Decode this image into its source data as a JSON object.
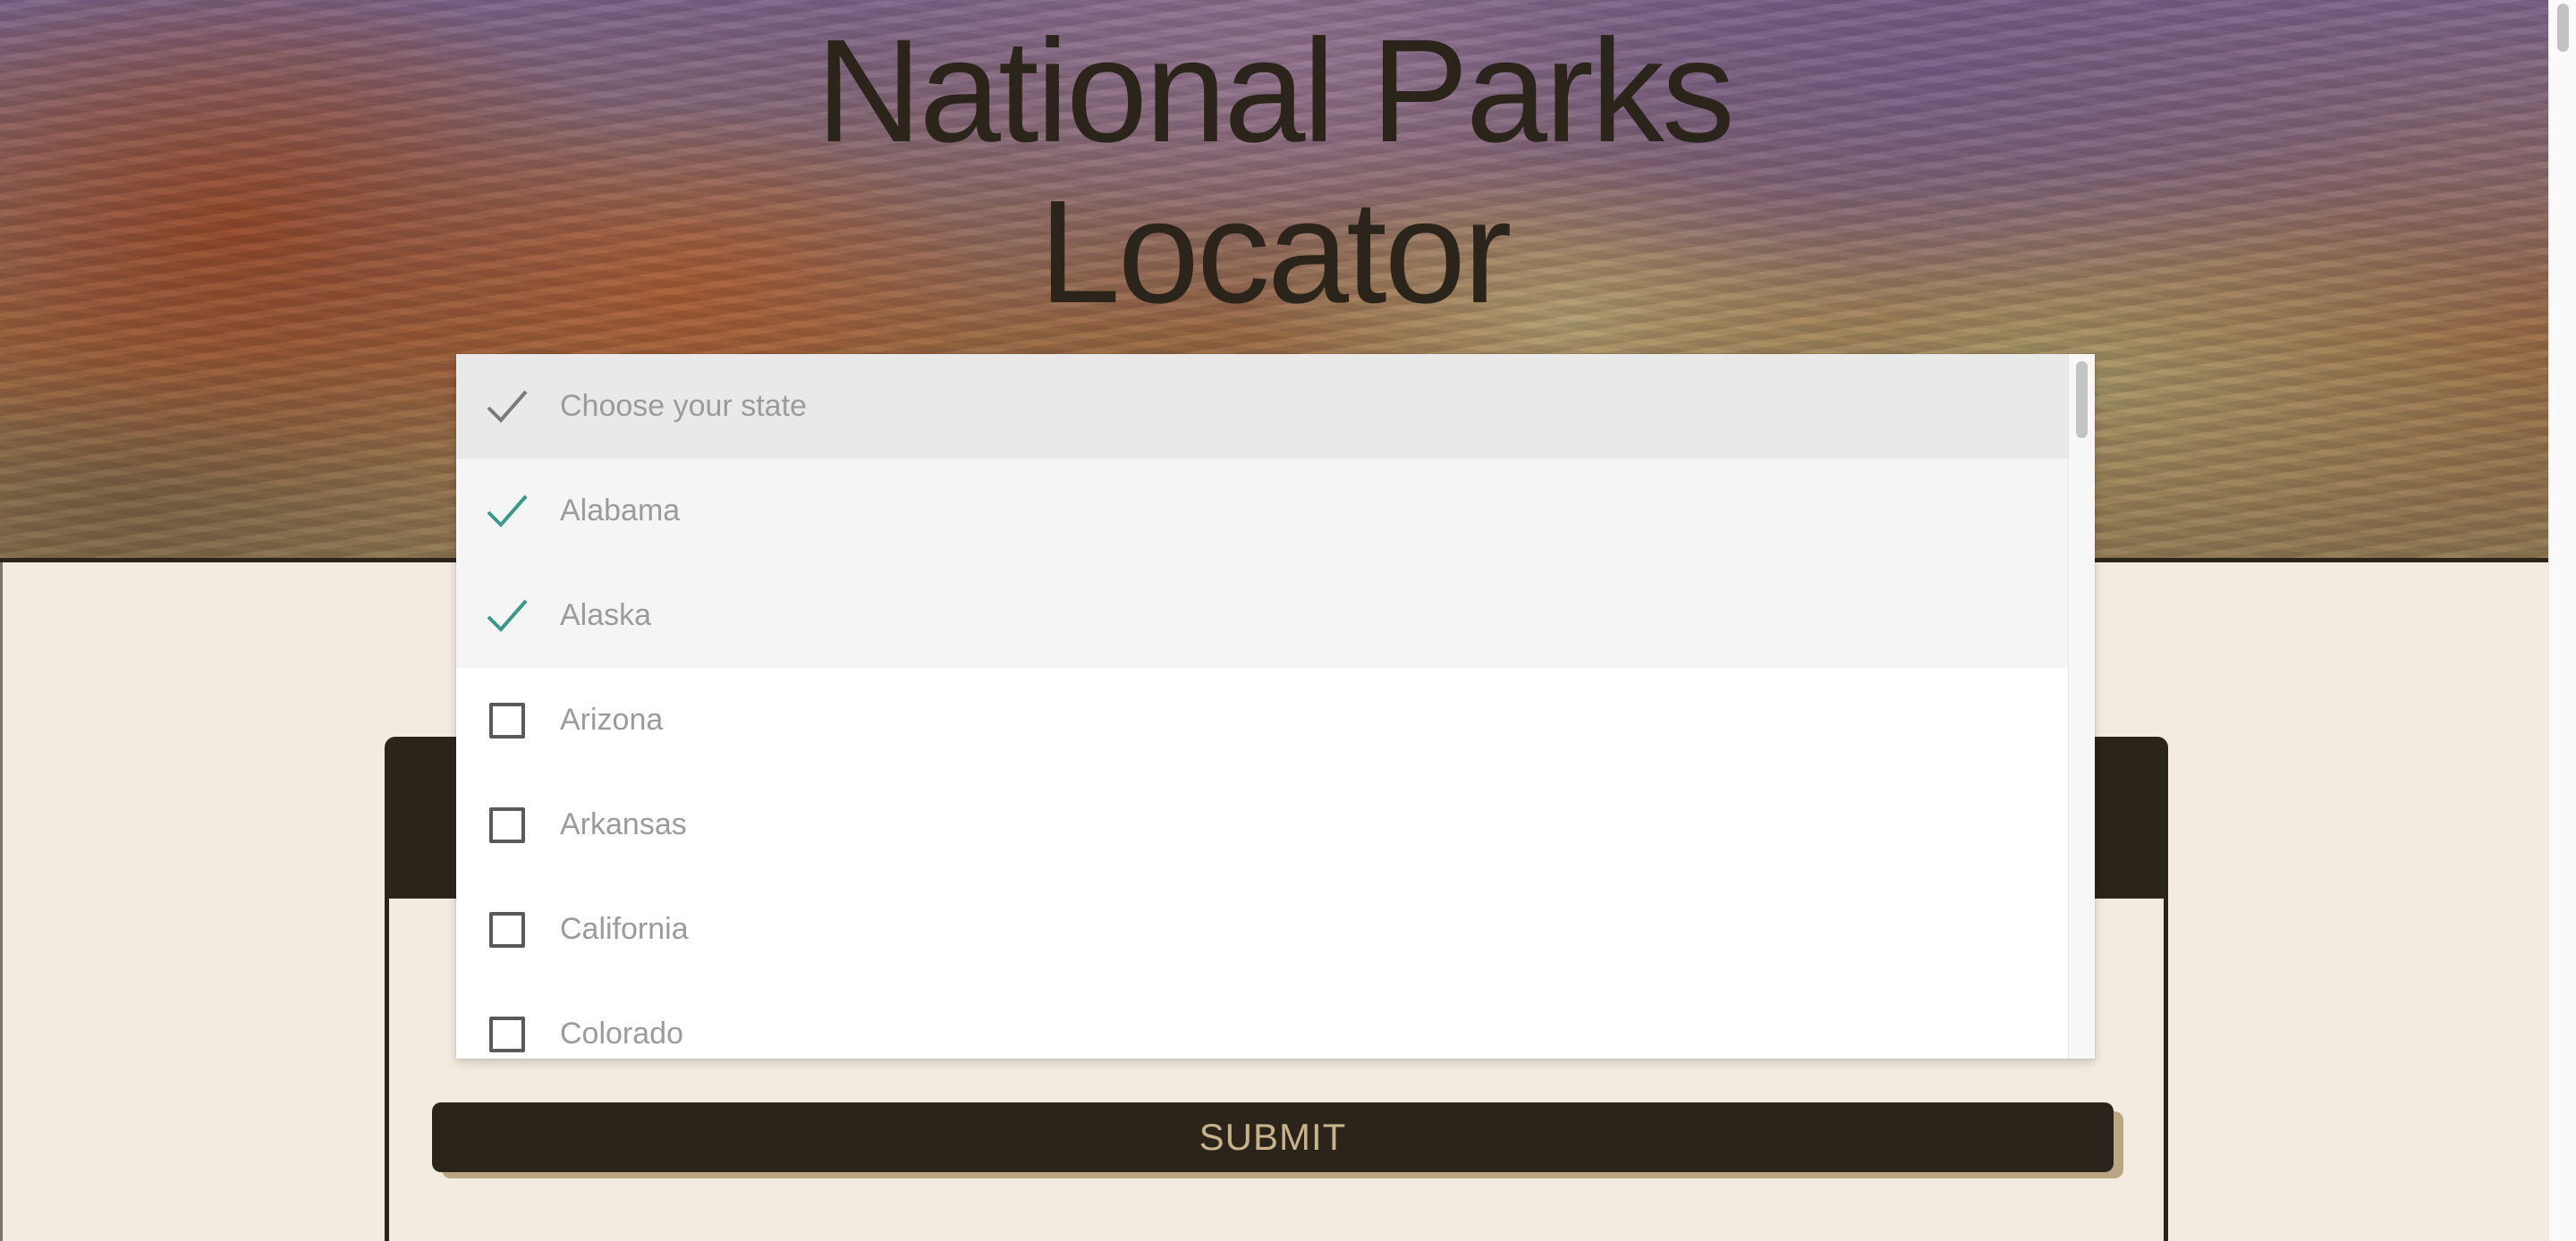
{
  "page": {
    "title_line1": "National Parks",
    "title_line2": "Locator"
  },
  "colors": {
    "primary_dark": "#2b241a",
    "background": "#f3ebdf",
    "submit_text": "#c7b28a",
    "check_selected": "#3a9a8a",
    "option_text": "#9b9b9b"
  },
  "state_select": {
    "placeholder": "Choose your state",
    "options": [
      {
        "label": "Alabama",
        "selected": true
      },
      {
        "label": "Alaska",
        "selected": true
      },
      {
        "label": "Arizona",
        "selected": false
      },
      {
        "label": "Arkansas",
        "selected": false
      },
      {
        "label": "California",
        "selected": false
      },
      {
        "label": "Colorado",
        "selected": false
      }
    ]
  },
  "form": {
    "submit_label": "SUBMIT"
  }
}
